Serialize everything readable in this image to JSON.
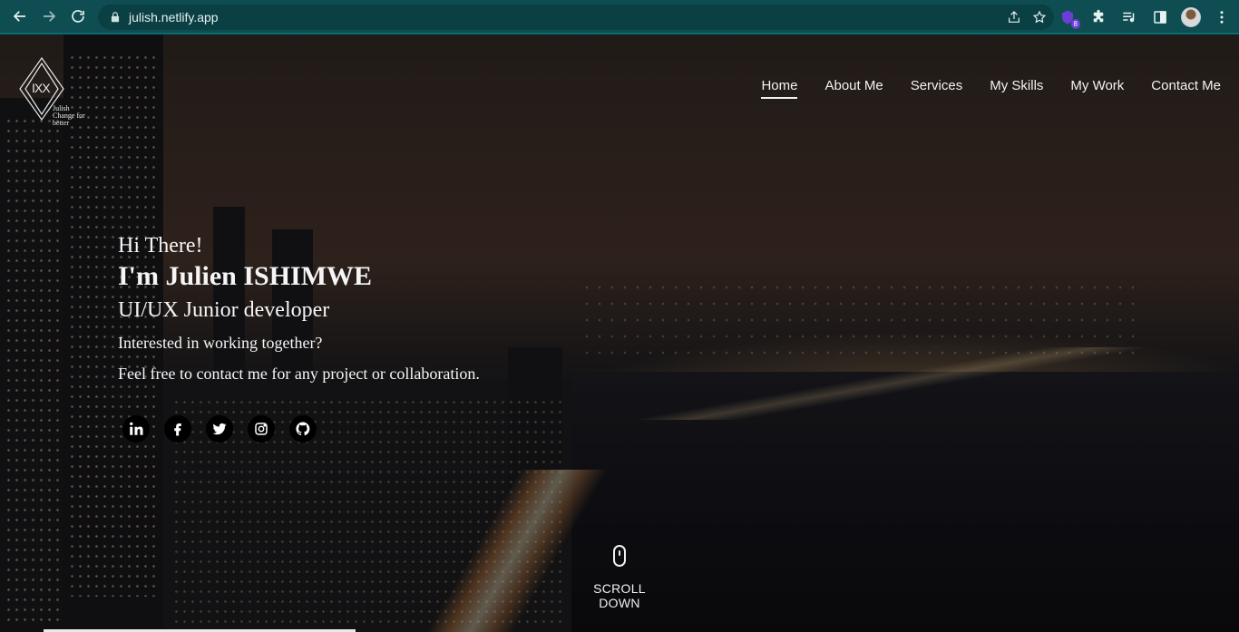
{
  "browser": {
    "url": "julish.netlify.app",
    "extension_badge": "8"
  },
  "logo": {
    "monogram": "IXX",
    "text_line1": "Julish",
    "text_line2": "Change for better"
  },
  "nav": {
    "items": [
      {
        "label": "Home",
        "active": true
      },
      {
        "label": "About Me"
      },
      {
        "label": "Services"
      },
      {
        "label": "My Skills"
      },
      {
        "label": "My Work"
      },
      {
        "label": "Contact Me"
      }
    ]
  },
  "hero": {
    "greeting": "Hi There!",
    "name": "I'm Julien ISHIMWE",
    "role": "UI/UX Junior developer",
    "question": "Interested in working together?",
    "cta": "Feel free to contact me for any project or collaboration."
  },
  "social": [
    "linkedin-icon",
    "facebook-icon",
    "twitter-icon",
    "instagram-icon",
    "github-icon"
  ],
  "scroll": {
    "label": "SCROLL DOWN"
  },
  "colors": {
    "chrome_bg": "#0e4d52",
    "omnibox_bg": "#0a3f43"
  }
}
